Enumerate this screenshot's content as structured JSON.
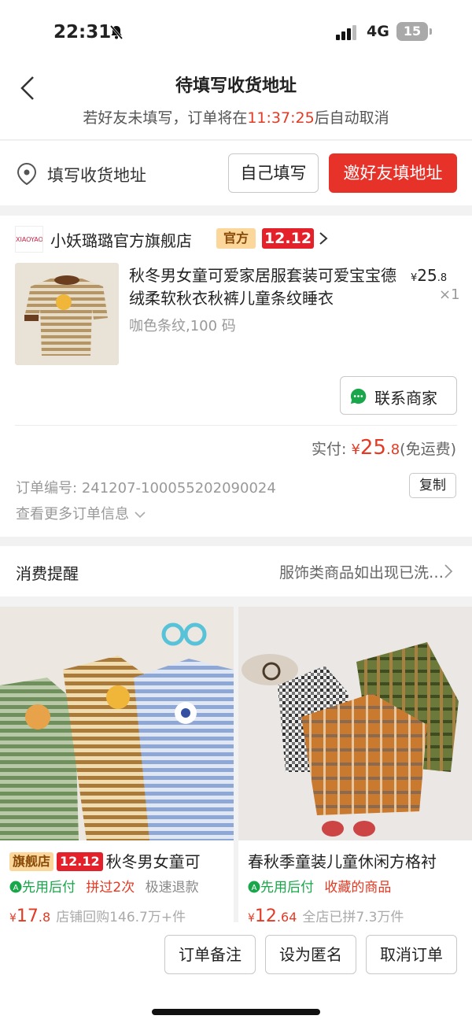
{
  "status_bar": {
    "time": "22:31",
    "network": "4G",
    "battery": "15"
  },
  "header": {
    "title": "待填写收货地址",
    "notice_prefix": "若好友未填写，订单将在",
    "countdown": "11:37:25",
    "notice_suffix": "后自动取消"
  },
  "address": {
    "label": "填写收货地址",
    "self_fill_button": "自己填写",
    "invite_button": "邀好友填地址"
  },
  "order": {
    "shop_logo_text": "XIAOYAOLULU",
    "shop_name": "小妖璐璐官方旗舰店",
    "official_tag": "官方",
    "promo_tag": "12.12",
    "product_title": "秋冬男女童可爱家居服套装可爱宝宝德绒柔软秋衣秋裤儿童条纹睡衣",
    "price_symbol": "¥",
    "price_int": "25",
    "price_dec": ".8",
    "quantity": "×1",
    "spec": "咖色条纹,100 码",
    "contact_button": "联系商家",
    "paid_label": "实付:",
    "paid_symbol": "¥",
    "paid_int": "25",
    "paid_dec": ".8",
    "shipping_note": "(免运费)",
    "order_no_label": "订单编号:",
    "order_no": "241207-100055202090024",
    "copy_button": "复制",
    "more_info": "查看更多订单信息"
  },
  "reminder": {
    "label": "消费提醒",
    "text": "服饰类商品如出现已洗…"
  },
  "recommendations": [
    {
      "store_tag": "旗舰店",
      "promo_tag": "12.12",
      "title": "秋冬男女童可",
      "pay_later": "先用后付",
      "tag2": "拼过2次",
      "tag3": "极速退款",
      "price_symbol": "¥",
      "price_int": "17",
      "price_dec": ".8",
      "sales": "店铺回购146.7万+件"
    },
    {
      "title": "春秋季童装儿童休闲方格衬",
      "pay_later": "先用后付",
      "tag2": "收藏的商品",
      "price_symbol": "¥",
      "price_int": "12",
      "price_dec": ".64",
      "sales": "全店已拼7.3万件"
    }
  ],
  "bottom_bar": {
    "note_button": "订单备注",
    "anon_button": "设为匿名",
    "cancel_button": "取消订单"
  },
  "colors": {
    "accent_red": "#e7322a",
    "price_red": "#e43a24",
    "pay_green": "#1aa64a"
  }
}
